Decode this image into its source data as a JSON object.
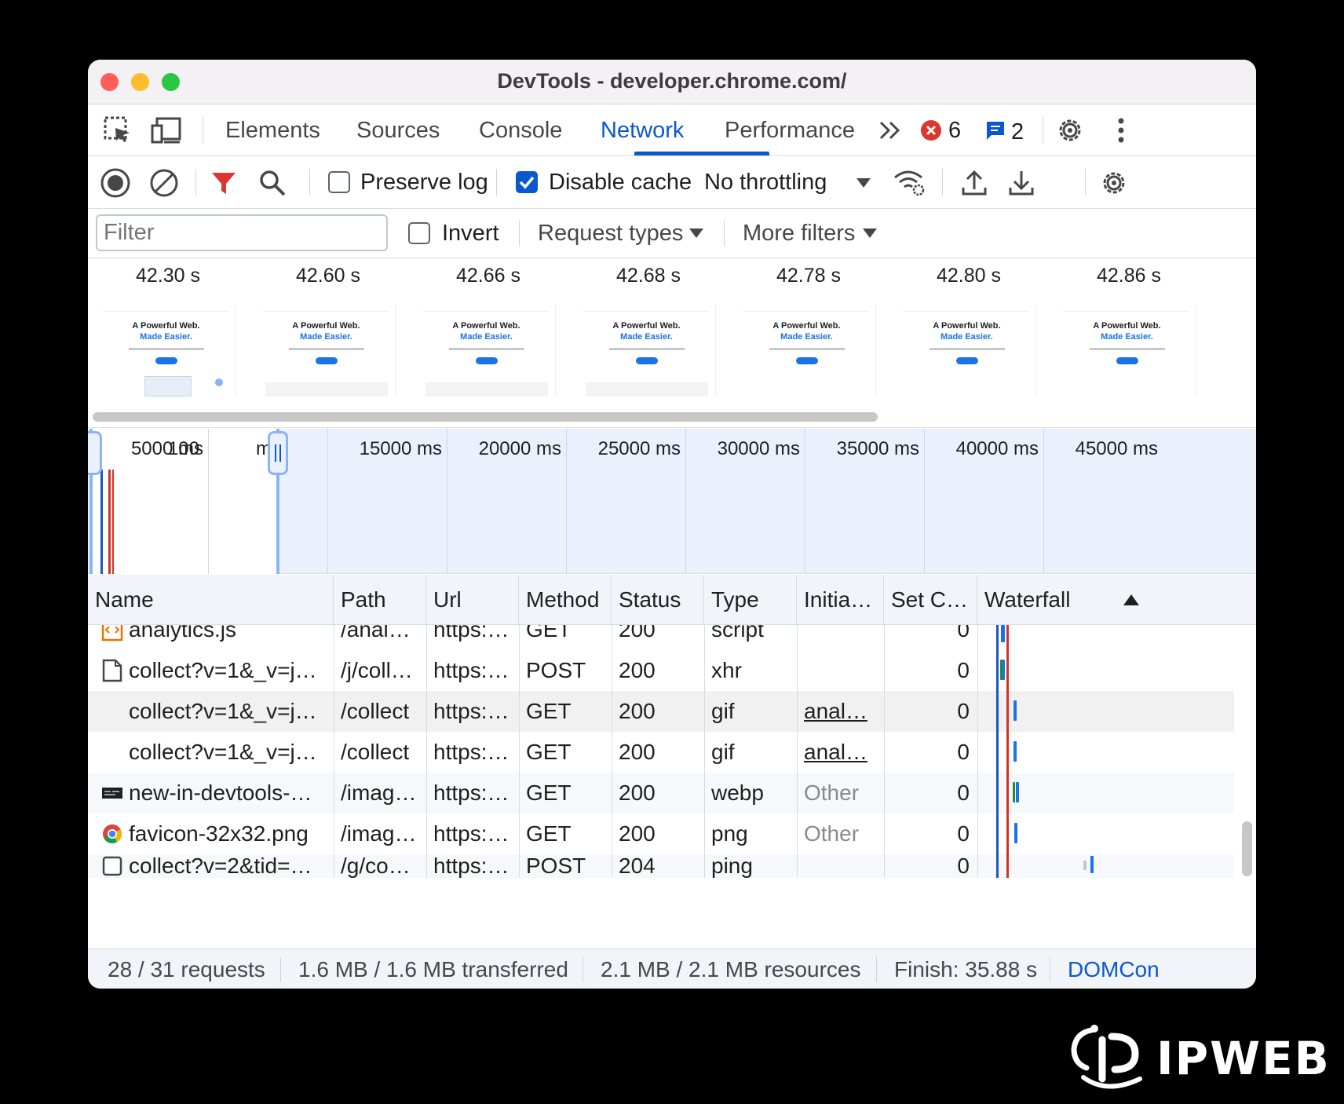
{
  "window": {
    "title": "DevTools - developer.chrome.com/"
  },
  "tabs": [
    {
      "label": "Elements",
      "active": false
    },
    {
      "label": "Sources",
      "active": false
    },
    {
      "label": "Console",
      "active": false
    },
    {
      "label": "Network",
      "active": true
    },
    {
      "label": "Performance",
      "active": false
    }
  ],
  "badges": {
    "errors": "6",
    "messages": "2"
  },
  "toolbar": {
    "preserve_log": {
      "label": "Preserve log",
      "checked": false
    },
    "disable_cache": {
      "label": "Disable cache",
      "checked": true
    },
    "throttling": "No throttling"
  },
  "filterbar": {
    "filter_placeholder": "Filter",
    "invert_label": "Invert",
    "request_types": "Request types",
    "more_filters": "More filters"
  },
  "filmstrip": {
    "frames": [
      {
        "time": "42.30 s",
        "headline": "A Powerful Web.",
        "subhead": "Made Easier."
      },
      {
        "time": "42.60 s",
        "headline": "A Powerful Web.",
        "subhead": "Made Easier."
      },
      {
        "time": "42.66 s",
        "headline": "A Powerful Web.",
        "subhead": "Made Easier."
      },
      {
        "time": "42.68 s",
        "headline": "A Powerful Web.",
        "subhead": "Made Easier."
      },
      {
        "time": "42.78 s",
        "headline": "A Powerful Web.",
        "subhead": "Made Easier."
      },
      {
        "time": "42.80 s",
        "headline": "A Powerful Web.",
        "subhead": "Made Easier."
      },
      {
        "time": "42.86 s",
        "headline": "A Powerful Web.",
        "subhead": "Made Easier."
      }
    ]
  },
  "overview": {
    "labels": [
      "5000 ms",
      "100",
      "ms",
      "15000 ms",
      "20000 ms",
      "25000 ms",
      "30000 ms",
      "35000 ms",
      "40000 ms",
      "45000 ms"
    ]
  },
  "table": {
    "columns": [
      "Name",
      "Path",
      "Url",
      "Method",
      "Status",
      "Type",
      "Initia…",
      "Set C…",
      "Waterfall"
    ],
    "rows": [
      {
        "icon": "script-icon",
        "name": "analytics.js",
        "path": "/anal…",
        "url": "https:…",
        "method": "GET",
        "status": "200",
        "type": "script",
        "initiator": "",
        "set_cookies": "0"
      },
      {
        "icon": "document-icon",
        "name": "collect?v=1&_v=j…",
        "path": "/j/coll…",
        "url": "https:…",
        "method": "POST",
        "status": "200",
        "type": "xhr",
        "initiator": "",
        "set_cookies": "0"
      },
      {
        "icon": "none",
        "name": "collect?v=1&_v=j…",
        "path": "/collect",
        "url": "https:…",
        "method": "GET",
        "status": "200",
        "type": "gif",
        "initiator": "anal…",
        "set_cookies": "0"
      },
      {
        "icon": "none",
        "name": "collect?v=1&_v=j…",
        "path": "/collect",
        "url": "https:…",
        "method": "GET",
        "status": "200",
        "type": "gif",
        "initiator": "anal…",
        "set_cookies": "0"
      },
      {
        "icon": "image-icon",
        "name": "new-in-devtools-…",
        "path": "/imag…",
        "url": "https:…",
        "method": "GET",
        "status": "200",
        "type": "webp",
        "initiator": "Other",
        "set_cookies": "0"
      },
      {
        "icon": "chrome-icon",
        "name": "favicon-32x32.png",
        "path": "/imag…",
        "url": "https:…",
        "method": "GET",
        "status": "200",
        "type": "png",
        "initiator": "Other",
        "set_cookies": "0"
      },
      {
        "icon": "checkbox-icon",
        "name": "collect?v=2&tid=…",
        "path": "/g/co…",
        "url": "https:…",
        "method": "POST",
        "status": "204",
        "type": "ping",
        "initiator": "",
        "set_cookies": "0"
      }
    ]
  },
  "statusbar": {
    "requests": "28 / 31 requests",
    "transferred": "1.6 MB / 1.6 MB transferred",
    "resources": "2.1 MB / 2.1 MB resources",
    "finish": "Finish: 35.88 s",
    "domcontent": "DOMCon"
  },
  "watermark": {
    "text": "IPWEB"
  },
  "colors": {
    "accent": "#0b57d0",
    "error": "#dc362e",
    "dcl_line": "#1a56c4",
    "load_line": "#d93025"
  }
}
